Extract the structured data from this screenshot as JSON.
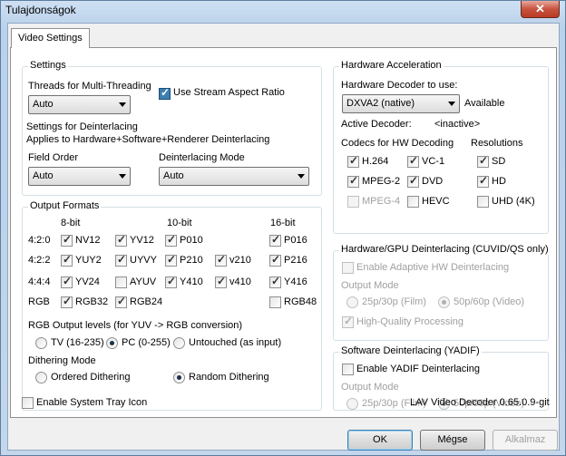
{
  "window": {
    "title": "Tulajdonságok",
    "close": "✕"
  },
  "tab": "Video Settings",
  "settings": {
    "title": "Settings",
    "threads_label": "Threads for Multi-Threading",
    "threads_value": "Auto",
    "stream_aspect": "Use Stream Aspect Ratio",
    "deint_line1": "Settings for Deinterlacing",
    "deint_line2": "Applies to Hardware+Software+Renderer Deinterlacing",
    "field_order_label": "Field Order",
    "field_order_value": "Auto",
    "deint_mode_label": "Deinterlacing Mode",
    "deint_mode_value": "Auto"
  },
  "formats": {
    "title": "Output Formats",
    "col_8bit": "8-bit",
    "col_10bit": "10-bit",
    "col_16bit": "16-bit",
    "row_420": "4:2:0",
    "row_422": "4:2:2",
    "row_444": "4:4:4",
    "row_rgb": "RGB",
    "nv12": "NV12",
    "yv12": "YV12",
    "p010": "P010",
    "p016": "P016",
    "yuy2": "YUY2",
    "uyvy": "UYVY",
    "p210": "P210",
    "v210": "v210",
    "p216": "P216",
    "yv24": "YV24",
    "ayuv": "AYUV",
    "y410": "Y410",
    "v410": "v410",
    "y416": "Y416",
    "rgb32": "RGB32",
    "rgb24": "RGB24",
    "rgb48": "RGB48",
    "levels_label": "RGB Output levels (for YUV -> RGB conversion)",
    "tv": "TV (16-235)",
    "pc": "PC (0-255)",
    "untouched": "Untouched (as input)",
    "dither_label": "Dithering Mode",
    "ordered": "Ordered Dithering",
    "random": "Random Dithering"
  },
  "hw": {
    "title": "Hardware Acceleration",
    "decoder_label": "Hardware Decoder to use:",
    "decoder_value": "DXVA2 (native)",
    "available": "Available",
    "active_label": "Active Decoder:",
    "active_value": "<inactive>",
    "codecs_label": "Codecs for HW Decoding",
    "res_label": "Resolutions",
    "h264": "H.264",
    "vc1": "VC-1",
    "sd": "SD",
    "mpeg2": "MPEG-2",
    "dvd": "DVD",
    "hd": "HD",
    "mpeg4": "MPEG-4",
    "hevc": "HEVC",
    "uhd": "UHD (4K)"
  },
  "gpu_deint": {
    "title": "Hardware/GPU Deinterlacing (CUVID/QS only)",
    "adaptive": "Enable Adaptive HW Deinterlacing",
    "output_mode": "Output Mode",
    "film": "25p/30p (Film)",
    "video": "50p/60p (Video)",
    "hq": "High-Quality Processing"
  },
  "sw_deint": {
    "title": "Software Deinterlacing (YADIF)",
    "enable": "Enable YADIF Deinterlacing",
    "output_mode": "Output Mode",
    "film": "25p/30p (Film)",
    "video": "50p/60p (Video)"
  },
  "footer": {
    "tray": "Enable System Tray Icon",
    "version": "LAV Video Decoder 0.65.0.9-git"
  },
  "buttons": {
    "ok": "OK",
    "cancel": "Mégse",
    "apply": "Alkalmaz"
  }
}
